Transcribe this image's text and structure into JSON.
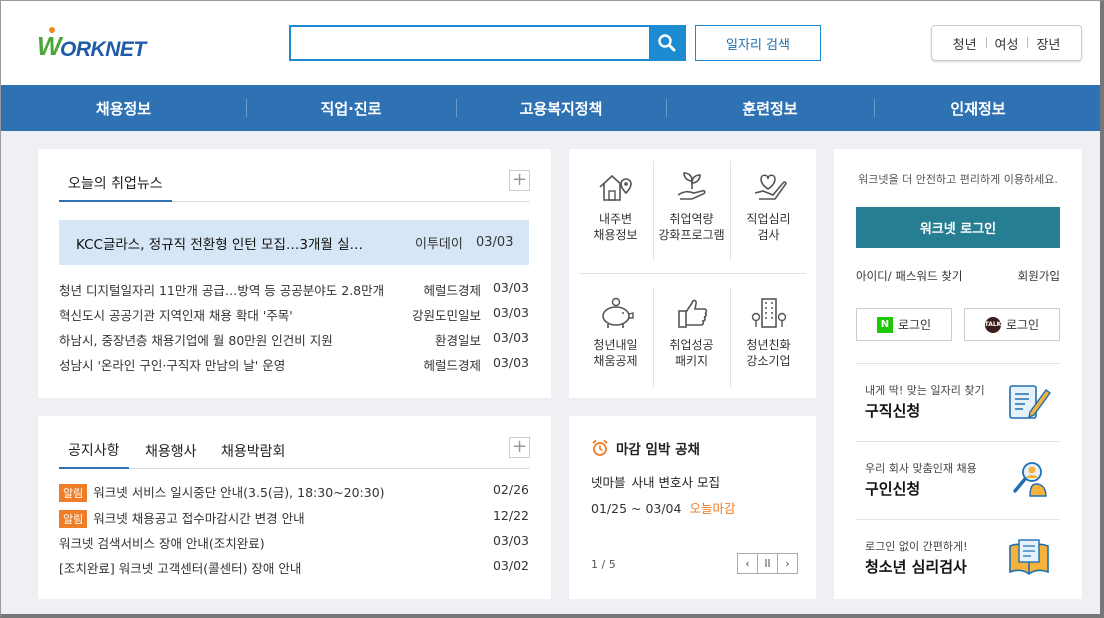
{
  "header": {
    "logo_text": "WORKNET",
    "search": {
      "value": "",
      "placeholder": ""
    },
    "job_search_label": "일자리 검색",
    "quick_links": [
      "청년",
      "여성",
      "장년"
    ]
  },
  "gnb": [
    "채용정보",
    "직업·진로",
    "고용복지정책",
    "훈련정보",
    "인재정보"
  ],
  "news": {
    "tab_label": "오늘의 취업뉴스",
    "more_label": "+",
    "highlight": {
      "title": "KCC글라스, 정규직 전환형 인턴 모집…3개월 실…",
      "source": "이투데이",
      "date": "03/03"
    },
    "items": [
      {
        "title": "청년 디지털일자리 11만개 공급…방역 등 공공분야도 2.8만개",
        "source": "헤럴드경제",
        "date": "03/03"
      },
      {
        "title": "혁신도시 공공기관 지역인재 채용 확대 '주목'",
        "source": "강원도민일보",
        "date": "03/03"
      },
      {
        "title": "하남시, 중장년층 채용기업에 월 80만원 인건비 지원",
        "source": "환경일보",
        "date": "03/03"
      },
      {
        "title": "성남시 '온라인 구인·구직자 만남의 날' 운영",
        "source": "헤럴드경제",
        "date": "03/03"
      }
    ]
  },
  "services": [
    {
      "line1": "내주변",
      "line2": "채용정보",
      "icon": "house-map-pin-icon"
    },
    {
      "line1": "취업역량",
      "line2": "강화프로그램",
      "icon": "sprout-hand-icon"
    },
    {
      "line1": "직업심리",
      "line2": "검사",
      "icon": "heart-hand-icon"
    },
    {
      "line1": "청년내일",
      "line2": "채움공제",
      "icon": "piggy-bank-icon"
    },
    {
      "line1": "취업성공",
      "line2": "패키지",
      "icon": "thumbs-up-icon"
    },
    {
      "line1": "청년친화",
      "line2": "강소기업",
      "icon": "building-icon"
    }
  ],
  "login": {
    "message": "워크넷을 더 안전하고 편리하게 이용하세요.",
    "login_button": "워크넷 로그인",
    "find_label": "아이디/ 패스워드 찾기",
    "join_label": "회원가입",
    "naver_label": "로그인",
    "naver_icon": "N",
    "kakao_label": "로그인",
    "kakao_icon": "TALK",
    "promos": [
      {
        "small": "내게 딱! 맞는 일자리 찾기",
        "big": "구직신청",
        "icon": "resume-pen-icon"
      },
      {
        "small": "우리 회사 맞춤인재 채용",
        "big": "구인신청",
        "icon": "person-magnifier-icon"
      },
      {
        "small": "로그인 없이 간편하게!",
        "big": "청소년 심리검사",
        "icon": "book-icon"
      }
    ]
  },
  "notice": {
    "tabs": [
      "공지사항",
      "채용행사",
      "채용박람회"
    ],
    "more_label": "+",
    "items": [
      {
        "tag": "알림",
        "title": "워크넷 서비스 일시중단 안내(3.5(금), 18:30~20:30)",
        "date": "02/26"
      },
      {
        "tag": "알림",
        "title": "워크넷 채용공고 접수마감시간 변경 안내",
        "date": "12/22"
      },
      {
        "tag": "",
        "title": "워크넷 검색서비스 장애 안내(조치완료)",
        "date": "03/03"
      },
      {
        "tag": "",
        "title": "[조치완료] 워크넷 고객센터(콜센터) 장애 안내",
        "date": "03/02"
      }
    ]
  },
  "deadline": {
    "title": "마감 임박 공채",
    "company": "넷마블",
    "job": "사내 변호사 모집",
    "period": "01/25 ~ 03/04",
    "status": "오늘마감",
    "page": "1 / 5",
    "prev": "‹",
    "pause": "ll",
    "next": "›"
  },
  "colors": {
    "gnb": "#2e72b4",
    "login_button": "#267e93",
    "accent_orange": "#ee7d28",
    "search_blue": "#1d8bd1"
  }
}
